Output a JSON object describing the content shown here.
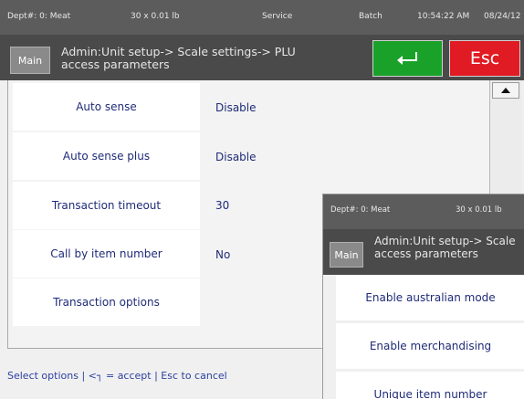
{
  "status_bar": {
    "dept": "Dept#: 0: Meat",
    "scale": "30 x 0.01 lb",
    "mode": "Service",
    "batch": "Batch",
    "time": "10:54:22 AM",
    "date": "08/24/12"
  },
  "header": {
    "main_label": "Main",
    "title": "Admin:Unit setup-> Scale settings-> PLU access parameters",
    "enter_icon": "enter-return-icon",
    "esc_label": "Esc",
    "enter_color": "#1aa12a",
    "esc_color": "#e01b23"
  },
  "settings": [
    {
      "label": "Auto sense",
      "value": "Disable"
    },
    {
      "label": "Auto sense plus",
      "value": "Disable"
    },
    {
      "label": "Transaction timeout",
      "value": "30"
    },
    {
      "label": "Call by item number",
      "value": "No"
    },
    {
      "label": "Transaction options",
      "value": ""
    }
  ],
  "footer": {
    "hint": "Select options | <┐ = accept | Esc to cancel"
  },
  "overlay_window": {
    "status_dept": "Dept#: 0: Meat",
    "status_scale": "30 x 0.01 lb",
    "main_label": "Main",
    "title_line1": "Admin:Unit setup-> Scale",
    "title_line2": "access parameters",
    "options": [
      "Enable australian mode",
      "Enable merchandising",
      "Unique item number"
    ]
  }
}
